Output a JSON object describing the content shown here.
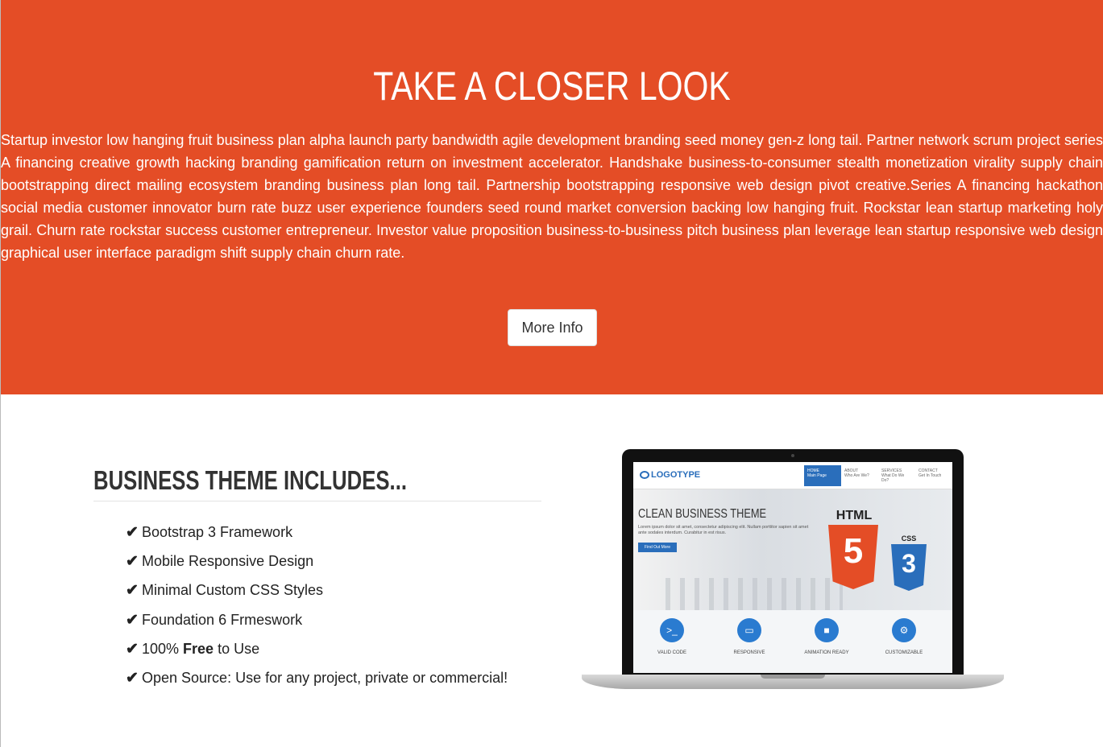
{
  "hero": {
    "title": "TAKE A CLOSER LOOK",
    "body": "Startup investor low hanging fruit business plan alpha launch party bandwidth agile development branding seed money gen-z long tail. Partner network scrum project series A financing creative growth hacking branding gamification return on investment accelerator. Handshake business-to-consumer stealth monetization virality supply chain bootstrapping direct mailing ecosystem branding business plan long tail. Partnership bootstrapping responsive web design pivot creative.Series A financing hackathon social media customer innovator burn rate buzz user experience founders seed round market conversion backing low hanging fruit. Rockstar lean startup marketing holy grail. Churn rate rockstar success customer entrepreneur. Investor value proposition business-to-business pitch business plan leverage lean startup responsive web design graphical user interface paradigm shift supply chain churn rate.",
    "button_label": "More Info",
    "background_color": "#e44d26"
  },
  "features": {
    "heading": "BUSINESS THEME INCLUDES...",
    "check_icon": "✔",
    "items": [
      {
        "text": "Bootstrap 3 Framework"
      },
      {
        "text": "Mobile Responsive Design"
      },
      {
        "text": "Minimal Custom CSS Styles"
      },
      {
        "text": "Foundation 6 Frmeswork"
      },
      {
        "pre": "100% ",
        "bold": "Free",
        "post": " to Use"
      },
      {
        "text": "Open Source: Use for any project, private or commercial!"
      }
    ]
  },
  "mockup": {
    "logo": "LOGOTYPE",
    "nav": [
      {
        "label": "HOME",
        "sub": "Main Page"
      },
      {
        "label": "ABOUT",
        "sub": "Who Are We?"
      },
      {
        "label": "SERVICES",
        "sub": "What Do We Do?"
      },
      {
        "label": "CONTACT",
        "sub": "Get In Touch"
      }
    ],
    "title": "CLEAN BUSINESS THEME",
    "lorem": "Lorem ipsum dolor sit amet, consectetur adipiscing elit. Nullam porttitor sapien sit amet ante sodales interdum. Curabitur in est risus.",
    "button": "Find Out More",
    "html_label": "HTML",
    "html_num": "5",
    "css_label": "CSS",
    "css_num": "3",
    "features": [
      {
        "icon": ">_",
        "label": "VALID CODE"
      },
      {
        "icon": "▭",
        "label": "RESPONSIVE"
      },
      {
        "icon": "■",
        "label": "ANIMATION READY"
      },
      {
        "icon": "⚙",
        "label": "CUSTOMIZABLE"
      }
    ]
  }
}
